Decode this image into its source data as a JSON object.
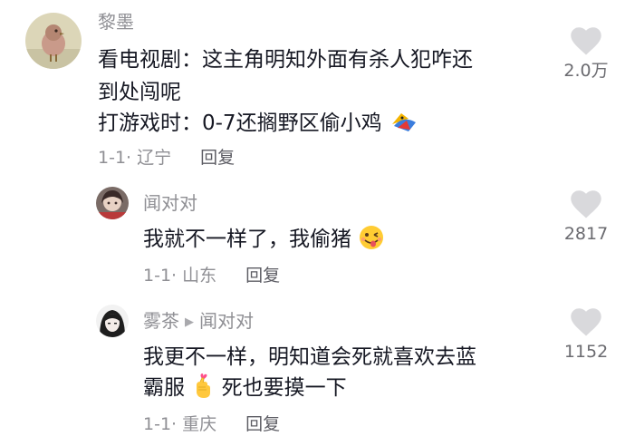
{
  "comments": [
    {
      "username": "黎墨",
      "lines": [
        "看电视剧：这主角明知外面有杀人犯咋还",
        "到处闯呢",
        "打游戏时：0-7还搁野区偷小鸡"
      ],
      "meta": "1-1· 辽宁",
      "reply_label": "回复",
      "likes": "2.0万",
      "emoji": "chicken-emoji"
    },
    {
      "username": "闻对对",
      "lines": [
        "我就不一样了，我偷猪"
      ],
      "meta": "1-1· 山东",
      "reply_label": "回复",
      "likes": "2817",
      "emoji": "winking-tongue-emoji"
    },
    {
      "username": "雾茶",
      "reply_to": "闻对对",
      "lines": [
        "我更不一样，明知道会死就喜欢去蓝",
        "霸服",
        "死也要摸一下"
      ],
      "meta": "1-1· 重庆",
      "reply_label": "回复",
      "likes": "1152",
      "emoji": "finger-heart-emoji"
    }
  ],
  "colors": {
    "text": "#161823",
    "secondary": "#8f8f94",
    "like_icon": "#d9d9dc"
  }
}
